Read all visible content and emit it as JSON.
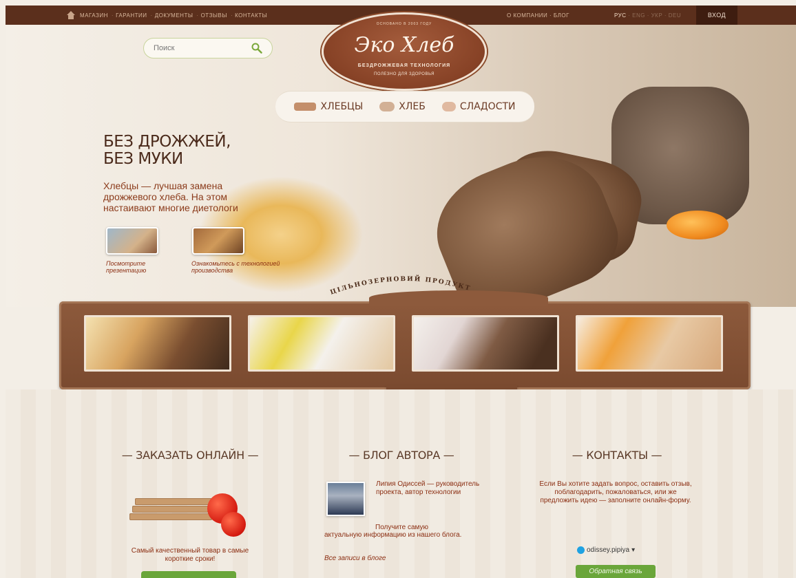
{
  "topbar": {
    "nav_left": [
      "МАГАЗИН",
      "ГАРАНТИИ",
      "ДОКУМЕНТЫ",
      "ОТЗЫВЫ",
      "КОНТАКТЫ"
    ],
    "nav_right": [
      "О КОМПАНИИ",
      "БЛОГ"
    ],
    "langs": [
      "РУС",
      "ENG",
      "УКР",
      "DEU"
    ],
    "login": "ВХОД"
  },
  "search": {
    "placeholder": "Поиск"
  },
  "logo": {
    "since": "ОСНОВАНО В 2003 ГОДУ",
    "brand": "Эко Хлеб",
    "tagline1": "БЕЗДРОЖЖЕВАЯ ТЕХНОЛОГИЯ",
    "tagline2": "ПОЛЕЗНО ДЛЯ ЗДОРОВЬЯ"
  },
  "categories": [
    "ХЛЕБЦЫ",
    "ХЛЕБ",
    "СЛАДОСТИ"
  ],
  "hero": {
    "title_line1": "БЕЗ ДРОЖЖЕЙ,",
    "title_line2": "БЕЗ МУКИ",
    "subtitle": "Хлебцы — лучшая замена дрожжевого хлеба. На этом настаивают многие диетологи",
    "link1": "Посмотрите презентацию",
    "link2": "Ознакомьтесь с технологией производства",
    "arc_text": "ЦІЛЬНОЗЕРНОВИЙ ПРОДУКТ"
  },
  "columns": {
    "order": {
      "title": "— ЗАКАЗАТЬ ОНЛАЙН —",
      "text": "Самый качественный товар в самые короткие сроки!"
    },
    "blog": {
      "title": "— БЛОГ АВТОРА —",
      "author": "Липия Одиссей — руководитель проекта, автор технологии",
      "text_indent": "Получите самую",
      "text_rest": "актуальную информацию из нашего блога.",
      "link": "Все записи в блоге"
    },
    "contacts": {
      "title": "— КОНТАКТЫ —",
      "text": "Если Вы хотите задать вопрос, оставить отзыв, поблагодарить, пожаловаться, или же предложить идею — заполните онлайн-форму.",
      "skype": "odissey.pipiya",
      "button": "Обратная связь"
    }
  },
  "colors": {
    "topbar": "#5b2f1c",
    "accent_red": "#8b2e12",
    "button_green": "#6aa63a",
    "gallery_brown": "#8d5a3c"
  }
}
